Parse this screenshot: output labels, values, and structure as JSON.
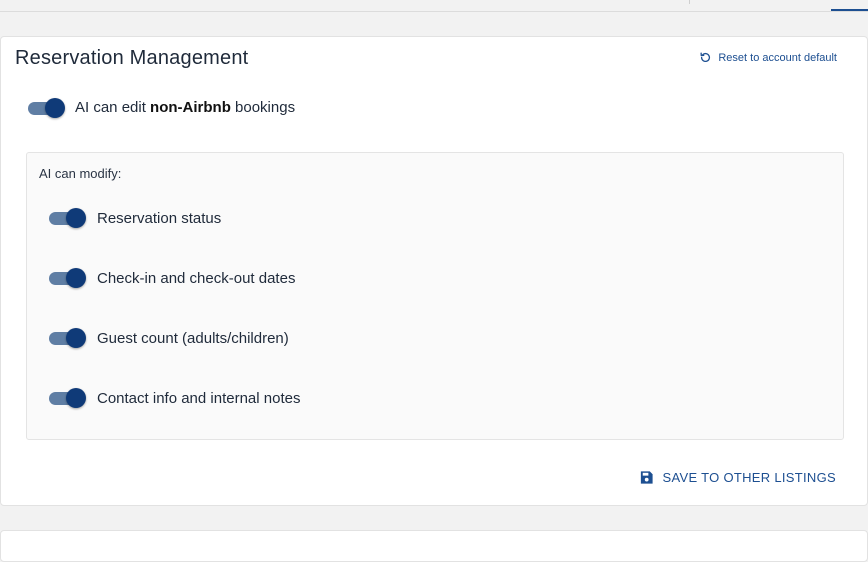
{
  "section": {
    "title": "Reservation Management",
    "reset_label": "Reset to account default"
  },
  "main_toggle": {
    "prefix": "AI can edit ",
    "bold": "non-Airbnb",
    "suffix": " bookings",
    "checked": true
  },
  "modify": {
    "title": "AI can modify:",
    "options": [
      {
        "label": "Reservation status",
        "checked": true
      },
      {
        "label": "Check-in and check-out dates",
        "checked": true
      },
      {
        "label": "Guest count (adults/children)",
        "checked": true
      },
      {
        "label": "Contact info and internal notes",
        "checked": true
      }
    ]
  },
  "save_button": {
    "label": "SAVE TO OTHER LISTINGS"
  },
  "colors": {
    "accent": "#1d4f91",
    "toggle_knob": "#0f3a78",
    "toggle_track": "#5f7ea4"
  },
  "icons": {
    "reset": "undo-icon",
    "save": "save-icon"
  }
}
